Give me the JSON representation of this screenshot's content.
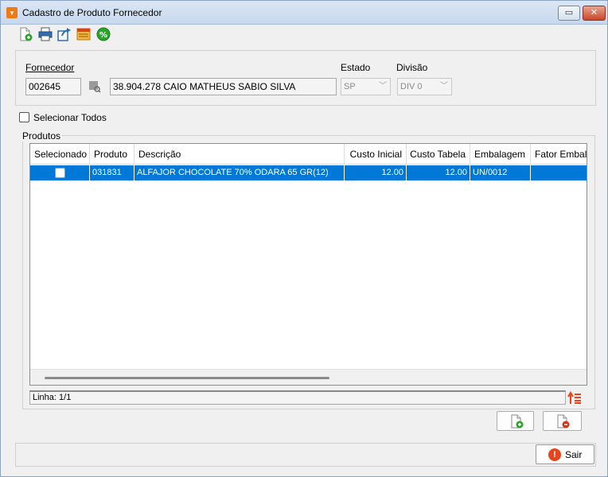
{
  "window": {
    "title": "Cadastro de Produto Fornecedor",
    "app_icon": "app-logo-icon",
    "accent_color": "#0078d7"
  },
  "toolbar": {
    "icons": [
      "new-document-icon",
      "print-icon",
      "export-icon",
      "report-icon",
      "percent-icon"
    ]
  },
  "fornecedor": {
    "label": "Fornecedor",
    "code": "002645",
    "name": "38.904.278 CAIO MATHEUS SABIO SILVA"
  },
  "estado": {
    "label": "Estado",
    "value": "SP"
  },
  "divisao": {
    "label": "Divisão",
    "value": "DIV 0"
  },
  "select_all_label": "Selecionar Todos",
  "produtos": {
    "group_label": "Produtos",
    "columns": [
      "Selecionado",
      "Produto",
      "Descrição",
      "Custo Inicial",
      "Custo Tabela",
      "Embalagem",
      "Fator Embal"
    ],
    "rows": [
      {
        "selected": false,
        "produto": "031831",
        "descricao": "ALFAJOR CHOCOLATE 70%  ODARA  65 GR(12)",
        "custo_inicial": "12.00",
        "custo_tabela": "12.00",
        "embalagem": "UN/0012",
        "fator_embal": ""
      }
    ]
  },
  "status": {
    "linha": "Linha: 1/1"
  },
  "buttons": {
    "sair": "Sair"
  }
}
